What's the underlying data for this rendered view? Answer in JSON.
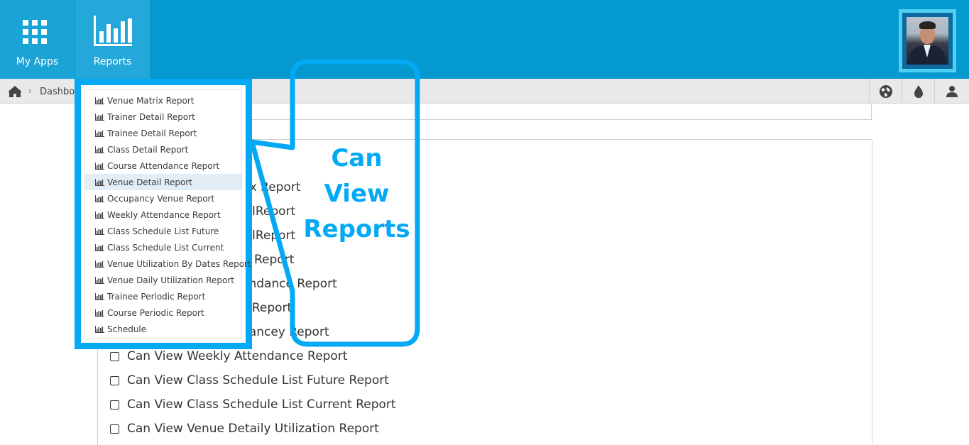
{
  "topbar": {
    "apps_label": "My Apps",
    "reports_label": "Reports"
  },
  "breadcrumb": {
    "current": "Dashboa"
  },
  "permissions": [
    {
      "label": "Can View Weekly Attendance Report"
    },
    {
      "label": "Can View Class Schedule List Future Report"
    },
    {
      "label": "Can View Class Schedule List Current Report"
    },
    {
      "label": "Can View Venue Detaily Utilization Report"
    }
  ],
  "partial_permissions": [
    {
      "label": "rix Report"
    },
    {
      "label": "ailReport"
    },
    {
      "label": "ailReport"
    },
    {
      "label": "Report"
    },
    {
      "label": "endance Report"
    },
    {
      "label": "il Report"
    },
    {
      "label": "pancey Report"
    }
  ],
  "dropdown": {
    "items": [
      {
        "label": "Venue Matrix Report"
      },
      {
        "label": "Trainer Detail Report"
      },
      {
        "label": "Trainee Detail Report"
      },
      {
        "label": "Class Detail Report"
      },
      {
        "label": "Course Attendance Report"
      },
      {
        "label": "Venue Detail Report"
      },
      {
        "label": "Occupancy Venue Report"
      },
      {
        "label": "Weekly Attendance Report"
      },
      {
        "label": "Class Schedule List Future"
      },
      {
        "label": "Class Schedule List Current"
      },
      {
        "label": "Venue Utilization By Dates Report"
      },
      {
        "label": "Venue Daily Utilization Report"
      },
      {
        "label": "Trainee Periodic Report"
      },
      {
        "label": "Course Periodic Report"
      },
      {
        "label": "Schedule"
      }
    ],
    "active_index": 5
  },
  "callout": {
    "line1": "Can",
    "line2": "View",
    "line3": "Reports"
  },
  "colors": {
    "topbar": "#0499cf",
    "highlight": "#03a9f4"
  }
}
